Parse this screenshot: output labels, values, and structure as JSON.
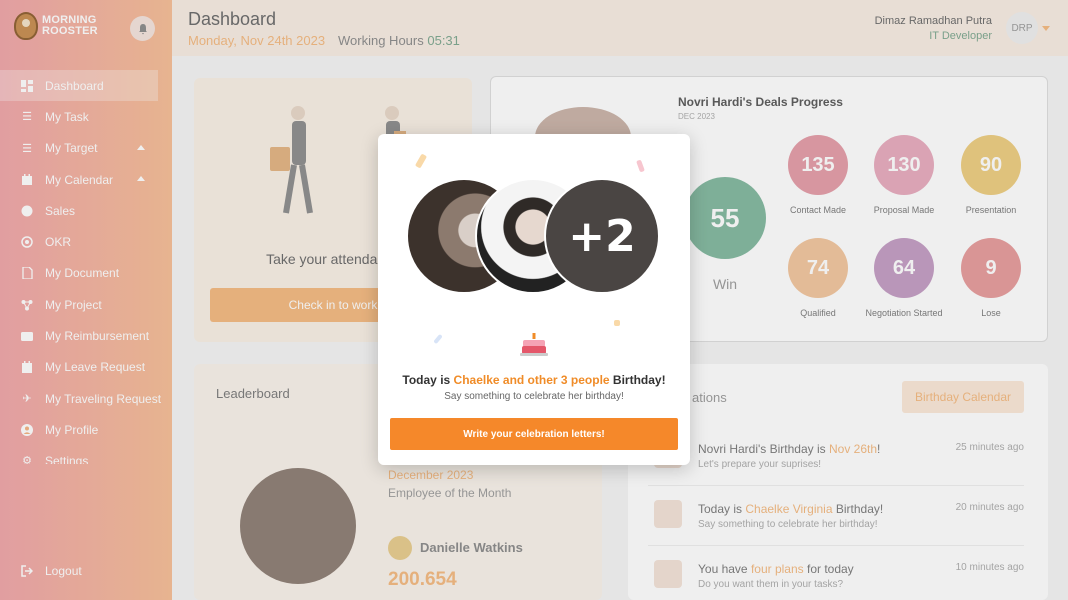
{
  "sidebar": {
    "logo_line1": "MORNING",
    "logo_line2": "ROOSTER",
    "bell_icon": "bell-icon",
    "items": [
      {
        "label": "Dashboard",
        "icon": "dashboard-icon"
      },
      {
        "label": "My Task",
        "icon": "list-icon"
      },
      {
        "label": "My Target",
        "icon": "checklist-icon"
      },
      {
        "label": "My Calendar",
        "icon": "calendar-icon"
      },
      {
        "label": "Sales",
        "icon": "sales-icon"
      },
      {
        "label": "OKR",
        "icon": "target-icon"
      },
      {
        "label": "My Document",
        "icon": "document-icon"
      },
      {
        "label": "My Project",
        "icon": "project-icon"
      },
      {
        "label": "My Reimbursement",
        "icon": "wallet-icon"
      },
      {
        "label": "My Leave Request",
        "icon": "leave-icon"
      },
      {
        "label": "My Traveling Request",
        "icon": "plane-icon"
      },
      {
        "label": "My Profile",
        "icon": "user-icon"
      },
      {
        "label": "Settings",
        "icon": "gear-icon"
      }
    ],
    "logout": "Logout"
  },
  "header": {
    "title": "Dashboard",
    "date": "Monday, Nov 24th 2023",
    "working_label": "Working Hours",
    "working_time": "05:31",
    "user_name": "Dimaz Ramadhan Putra",
    "user_role": "IT Developer",
    "initials": "DRP"
  },
  "attendance": {
    "text": "Take your attendance",
    "button": "Check in to work"
  },
  "deals": {
    "title": "Novri Hardi's Deals Progress",
    "subtitle": "DEC 2023",
    "win_value": "55",
    "win_label": "Win",
    "stats": [
      {
        "value": "135",
        "label": "Contact Made",
        "color": "#e49aa5"
      },
      {
        "value": "130",
        "label": "Proposal Made",
        "color": "#e7a9bc"
      },
      {
        "value": "90",
        "label": "Presentation",
        "color": "#edcc7d"
      },
      {
        "value": "74",
        "label": "Qualified",
        "color": "#f2c49b"
      },
      {
        "value": "64",
        "label": "Negotiation Started",
        "color": "#c29ac2"
      },
      {
        "value": "9",
        "label": "Lose",
        "color": "#e69999"
      }
    ]
  },
  "leaderboard": {
    "title": "Leaderboard",
    "month": "December 2023",
    "employee_label": "Employee of the Month",
    "name": "Danielle Watkins",
    "score": "200.654"
  },
  "notifications": {
    "title": "ations",
    "calendar_button": "Birthday Calendar",
    "items": [
      {
        "pre": "Novri Hardi's Birthday is ",
        "hl": "Nov 26th",
        "post": "!",
        "sub": "Let's prepare your suprises!",
        "time": "25 minutes ago"
      },
      {
        "pre": "Today is ",
        "hl": "Chaelke Virginia",
        "post": " Birthday!",
        "sub": "Say something to celebrate her birthday!",
        "time": "20 minutes ago"
      },
      {
        "pre": "You have ",
        "hl": "four plans",
        "post": " for today",
        "sub": "Do you want them in your tasks?",
        "time": "10 minutes ago"
      }
    ]
  },
  "modal": {
    "extra_count": "+2",
    "title_pre": "Today is ",
    "title_hl": "Chaelke and other 3 people",
    "title_post": " Birthday!",
    "subtitle": "Say something to celebrate her birthday!",
    "button": "Write your celebration letters!"
  }
}
